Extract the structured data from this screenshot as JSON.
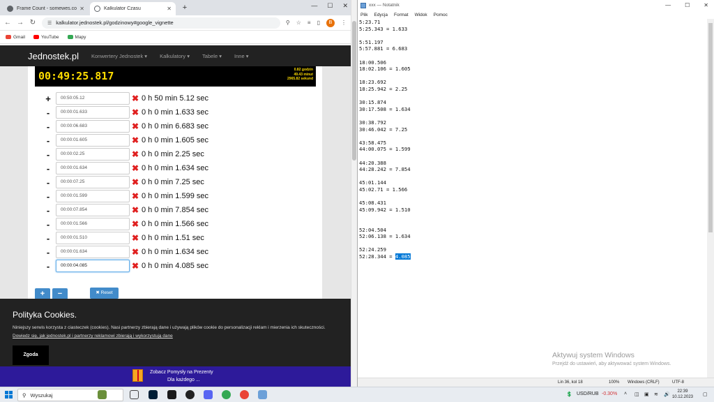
{
  "browser": {
    "tabs": [
      {
        "title": "Frame Count - somewes.com",
        "active": false
      },
      {
        "title": "Kalkulator Czasu",
        "active": true
      }
    ],
    "url": "kalkulator.jednostek.pl/godzinowy#google_vignette",
    "profile_letter": "B",
    "bookmarks": [
      "Gmail",
      "YouTube",
      "Mapy"
    ]
  },
  "site": {
    "brand": "Jednostek.pl",
    "nav": [
      "Konwertery Jednostek",
      "Kalkulatory",
      "Tabele",
      "Inne"
    ],
    "timer_main": "00:49:25.817",
    "timer_summary": [
      "0.82  godzin",
      "49.43  minut",
      "2965.82  sekund"
    ],
    "rows": [
      {
        "sign": "+",
        "value": "00:50:05.12",
        "result": "0 h 50 min 5.12 sec"
      },
      {
        "sign": "-",
        "value": "00:00:01.633",
        "result": "0 h 0 min 1.633 sec"
      },
      {
        "sign": "-",
        "value": "00:00:06.683",
        "result": "0 h 0 min 6.683 sec"
      },
      {
        "sign": "-",
        "value": "00:00:01.605",
        "result": "0 h 0 min 1.605 sec"
      },
      {
        "sign": "-",
        "value": "00:00:02.25",
        "result": "0 h 0 min 2.25 sec"
      },
      {
        "sign": "-",
        "value": "00:00:01.634",
        "result": "0 h 0 min 1.634 sec"
      },
      {
        "sign": "-",
        "value": "00:00:07.25",
        "result": "0 h 0 min 7.25 sec"
      },
      {
        "sign": "-",
        "value": "00:00:01.599",
        "result": "0 h 0 min 1.599 sec"
      },
      {
        "sign": "-",
        "value": "00:00:07.854",
        "result": "0 h 0 min 7.854 sec"
      },
      {
        "sign": "-",
        "value": "00:00:01.566",
        "result": "0 h 0 min 1.566 sec"
      },
      {
        "sign": "-",
        "value": "00:00:01.510",
        "result": "0 h 0 min 1.51 sec"
      },
      {
        "sign": "-",
        "value": "00:00:01.634",
        "result": "0 h 0 min 1.634 sec"
      },
      {
        "sign": "-",
        "value": "00:00:04.085",
        "result": "0 h 0 min 4.085 sec"
      }
    ],
    "add_label": "+",
    "sub_label": "−",
    "reset_label": "✖ Reset"
  },
  "cookie": {
    "title": "Polityka Cookies.",
    "text": "Niniejszy serwis korzysta z ciasteczek (cookies). Nasi partnerzy zbierają dane i używają plików cookie do personalizacji reklam i mierzenia ich skuteczności.",
    "link": "Dowiedz się, jak jednostek.pl i partnerzy reklamowi zbierają i wykorzystują dane",
    "agree": "Zgoda"
  },
  "promo": {
    "line1": "Zobacz Pomysły na Prezenty",
    "line2": "Dla każdego ..."
  },
  "notepad": {
    "title": "xxx — Notatnik",
    "menu": [
      "Plik",
      "Edycja",
      "Format",
      "Widok",
      "Pomoc"
    ],
    "lines": [
      "5:23.71",
      "5:25.343 = 1.633",
      "",
      "5:51.197",
      "5:57.881 = 6.683",
      "",
      "18:00.506",
      "18:02.106 = 1.605",
      "",
      "18:23.692",
      "18:25.942 = 2.25",
      "",
      "30:15.874",
      "30:17.508 = 1.634",
      "",
      "30:38.792",
      "30:46.042 = 7.25",
      "",
      "43:58.475",
      "44:00.075 = 1.599",
      "",
      "44:20.388",
      "44:28.242 = 7.854",
      "",
      "45:01.144",
      "45:02.71 = 1.566",
      "",
      "45:08.431",
      "45:09.942 = 1.510",
      "",
      "",
      "52:04.504",
      "52:06.138 = 1.634",
      "",
      "52:24.259"
    ],
    "last_prefix": "52:28.344 = ",
    "last_selected": "4.085",
    "watermark1": "Aktywuj system Windows",
    "watermark2": "Przejdź do ustawień, aby aktywować system Windows.",
    "status": {
      "pos": "Lin 36, kol 18",
      "zoom": "100%",
      "eol": "Windows (CRLF)",
      "enc": "UTF-8"
    }
  },
  "taskbar": {
    "search": "Wyszukaj",
    "ticker": "USD/RUB",
    "ticker_change": "-0.30%",
    "time": "22:39",
    "date": "10.12.2023"
  }
}
